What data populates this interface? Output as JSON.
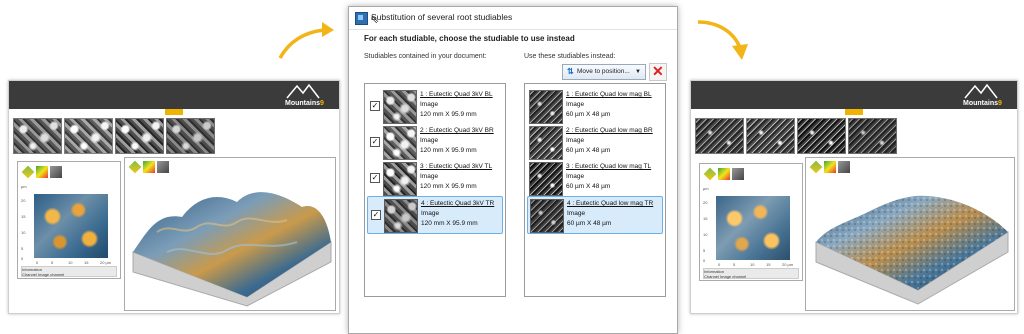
{
  "left_doc": {
    "logo_text": "Mountains",
    "logo_version": "9",
    "map_axis_unit": "µm",
    "map_x_ticks": [
      "0",
      "5",
      "10",
      "15",
      "20 µm"
    ],
    "map_y_ticks": [
      "20",
      "15",
      "10",
      "5",
      "0"
    ],
    "info_title": "Information",
    "info_row_label": "Channel",
    "info_row_value": "Image channel"
  },
  "right_doc": {
    "logo_text": "Mountains",
    "logo_version": "9",
    "map_axis_unit": "µm",
    "map_x_ticks": [
      "0",
      "5",
      "10",
      "15",
      "20 µm"
    ],
    "map_y_ticks": [
      "20",
      "15",
      "10",
      "5",
      "0"
    ],
    "info_title": "Information",
    "info_row_label": "Channel",
    "info_row_value": "Image channel"
  },
  "dialog": {
    "title": "Substitution of several root studiables",
    "instruction": "For each studiable, choose the studiable to use instead",
    "left_label": "Studiables contained in your document:",
    "right_label": "Use these studiables instead:",
    "move_button": "Move to position...",
    "delete_icon": "delete-x-icon",
    "source_items": [
      {
        "name": "1 : Eutectic Quad 3kV BL",
        "type": "Image",
        "size": "120 mm X 95.9 mm",
        "checked": true
      },
      {
        "name": "2 : Eutectic Quad 3kV BR",
        "type": "Image",
        "size": "120 mm X 95.9 mm",
        "checked": true
      },
      {
        "name": "3 : Eutectic Quad 3kV TL",
        "type": "Image",
        "size": "120 mm X 95.9 mm",
        "checked": true
      },
      {
        "name": "4 : Eutectic Quad 3kV TR",
        "type": "Image",
        "size": "120 mm X 95.9 mm",
        "checked": true
      }
    ],
    "target_items": [
      {
        "name": "1 : Eutectic Quad low mag BL",
        "type": "Image",
        "size": "60 µm X 48 µm"
      },
      {
        "name": "2 : Eutectic Quad low mag BR",
        "type": "Image",
        "size": "60 µm X 48 µm"
      },
      {
        "name": "3 : Eutectic Quad low mag TL",
        "type": "Image",
        "size": "60 µm X 48 µm"
      },
      {
        "name": "4 : Eutectic Quad low mag TR",
        "type": "Image",
        "size": "60 µm X 48 µm"
      }
    ]
  },
  "colors": {
    "header_dark": "#3b3b3b",
    "accent_yellow": "#f0b400",
    "arrow_orange": "#f2b417",
    "selection_blue": "#d8ebfb"
  }
}
